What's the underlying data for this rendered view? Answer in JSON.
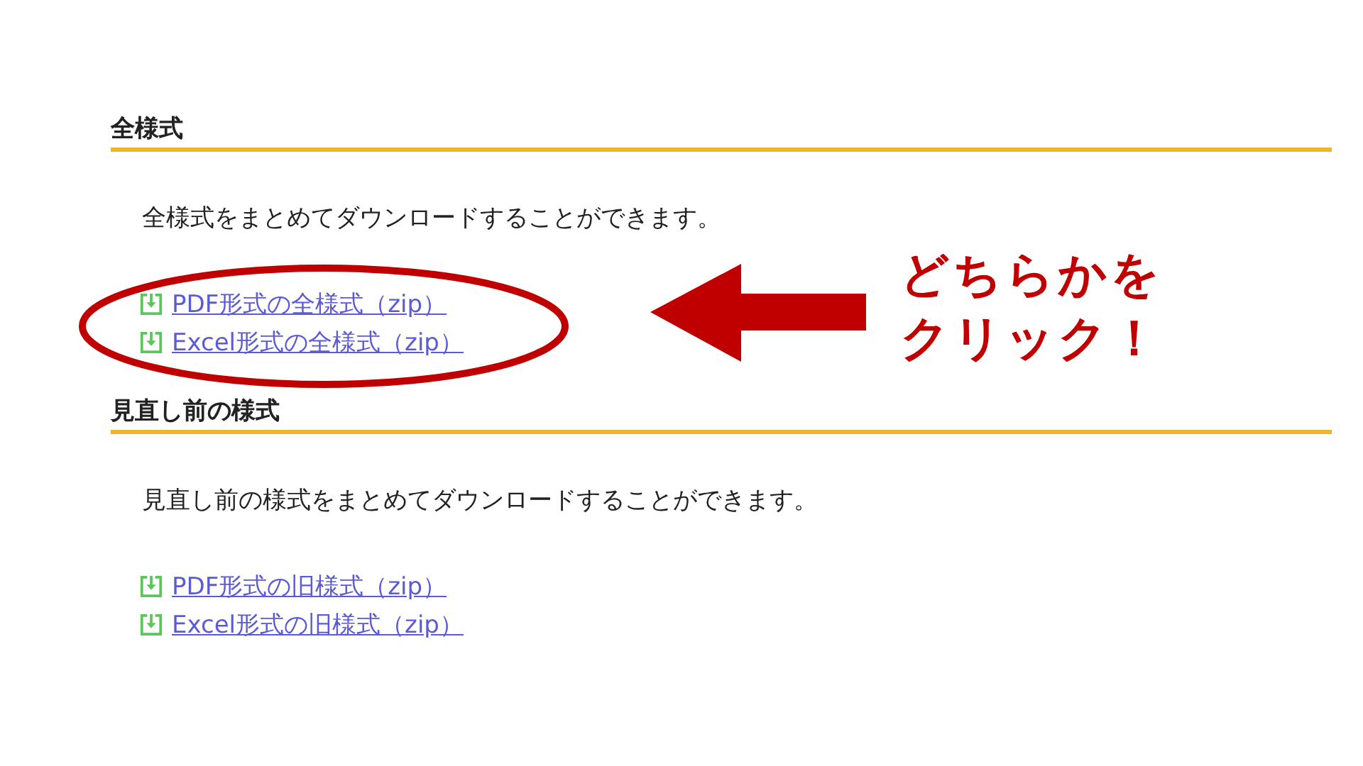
{
  "sections": [
    {
      "heading": "全様式",
      "description": "全様式をまとめてダウンロードすることができます。",
      "links": [
        {
          "label": "PDF形式の全様式（zip）"
        },
        {
          "label": "Excel形式の全様式（zip）"
        }
      ]
    },
    {
      "heading": "見直し前の様式",
      "description": "見直し前の様式をまとめてダウンロードすることができます。",
      "links": [
        {
          "label": "PDF形式の旧様式（zip）"
        },
        {
          "label": "Excel形式の旧様式（zip）"
        }
      ]
    }
  ],
  "annotation": {
    "lines": [
      "どちらかを",
      "クリック！"
    ]
  }
}
